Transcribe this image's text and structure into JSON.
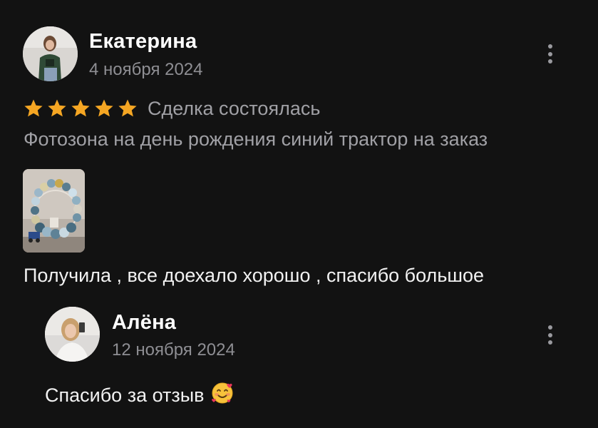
{
  "review": {
    "author": "Екатерина",
    "date": "4 ноября 2024",
    "rating": 5,
    "rating_max": 5,
    "status": "Сделка состоялась",
    "item_title": "Фотозона на день рождения синий трактор на заказ",
    "text": "Получила , все доехало хорошо , спасибо большое",
    "star_color": "#f5a623"
  },
  "reply": {
    "author": "Алёна",
    "date": "12 ноября 2024",
    "text": "Спасибо за отзыв",
    "emoji": "smiling-face-with-hearts-icon"
  }
}
